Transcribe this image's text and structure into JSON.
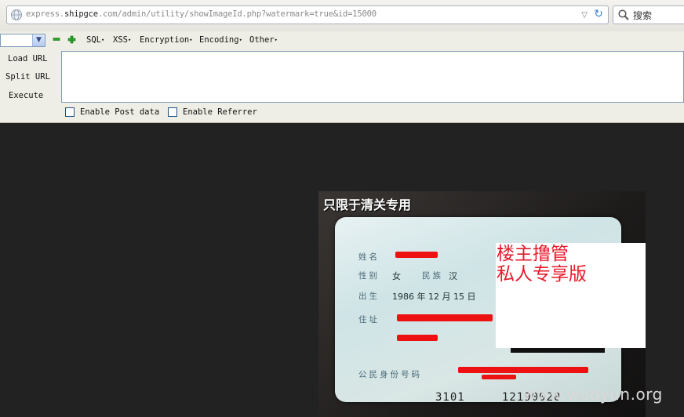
{
  "addressbar": {
    "url_host_prefix": "express.",
    "url_host_main": "shipgce",
    "url_host_suffix": ".com",
    "url_path": "/admin/utility/showImageId.php?watermark=true&id=15000",
    "search_placeholder": "搜索"
  },
  "hackbar": {
    "menus": [
      "SQL",
      "XSS",
      "Encryption",
      "Encoding",
      "Other"
    ],
    "actions": [
      "Load URL",
      "Split URL",
      "Execute"
    ],
    "textarea_value": "",
    "enable_post_label": "Enable Post data",
    "enable_referrer_label": "Enable Referrer"
  },
  "image": {
    "stamp_text": "只限于清关专用",
    "card": {
      "name_label": "姓名",
      "sex_label": "性别",
      "sex_value": "女",
      "ethnicity_label": "民族",
      "ethnicity_value": "汉",
      "birth_label": "出生",
      "birth_year": "1986",
      "birth_year_unit": "年",
      "birth_month": "12",
      "birth_month_unit": "月",
      "birth_day": "15",
      "birth_day_unit": "日",
      "address_label": "住址",
      "id_label": "公民身份号码",
      "id_number_visible": "3101",
      "id_number_tail": "12190020"
    },
    "overlay_line1": "楼主撸管",
    "overlay_line2": "私人专享版",
    "watermark": "www.wooyun.org"
  },
  "colors": {
    "page_bg": "#222222",
    "redaction": "#ee1111",
    "overlay_text": "#e8192a"
  }
}
